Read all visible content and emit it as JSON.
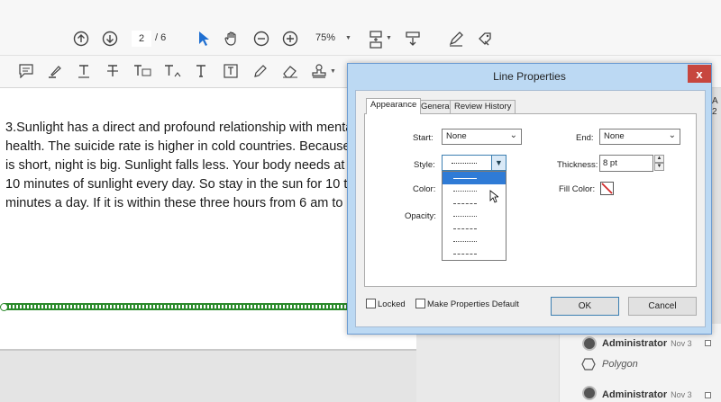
{
  "toolbar": {
    "page_current": "2",
    "page_total": "/ 6",
    "zoom": "75%",
    "icons": [
      "arrow-up-circle-icon",
      "arrow-down-circle-icon",
      "pointer-icon",
      "hand-icon",
      "zoom-out-icon",
      "zoom-in-icon",
      "fit-page-icon",
      "scroll-icon",
      "sign-icon",
      "fill-sign-icon"
    ],
    "markup_icons": [
      "comment-icon",
      "highlight-icon",
      "underline-icon",
      "strikethrough-icon",
      "replace-text-icon",
      "insert-text-icon",
      "text-icon",
      "textbox-icon",
      "pencil-icon",
      "eraser-icon",
      "stamp-icon"
    ]
  },
  "document": {
    "lines": [
      "3.Sunlight has a direct and profound relationship with mental",
      "health. The suicide rate is higher in cold countries. Because, d",
      "is short, night is big. Sunlight falls less. Your body needs at lea",
      "10 minutes of sunlight every day. So stay in the sun for 10 to 3",
      "minutes a day. If it is within these three hours from 6 am to 9"
    ]
  },
  "dialog": {
    "title": "Line Properties",
    "close": "x",
    "tabs": [
      "Appearance",
      "General",
      "Review History"
    ],
    "labels": {
      "start": "Start:",
      "end": "End:",
      "style": "Style:",
      "thickness": "Thickness:",
      "color": "Color:",
      "fill_color": "Fill Color:",
      "opacity": "Opacity:"
    },
    "start_value": "None",
    "end_value": "None",
    "thickness_value": "8 pt",
    "locked": "Locked",
    "make_default": "Make Properties Default",
    "ok": "OK",
    "cancel": "Cancel",
    "accent": "#2f7bd6"
  },
  "comments": {
    "items": [
      {
        "author": "Administrator",
        "date": "Nov 3",
        "type": "Polygon"
      },
      {
        "author": "Administrator",
        "date": "Nov 3"
      }
    ]
  },
  "side_text": [
    "A",
    "2"
  ]
}
